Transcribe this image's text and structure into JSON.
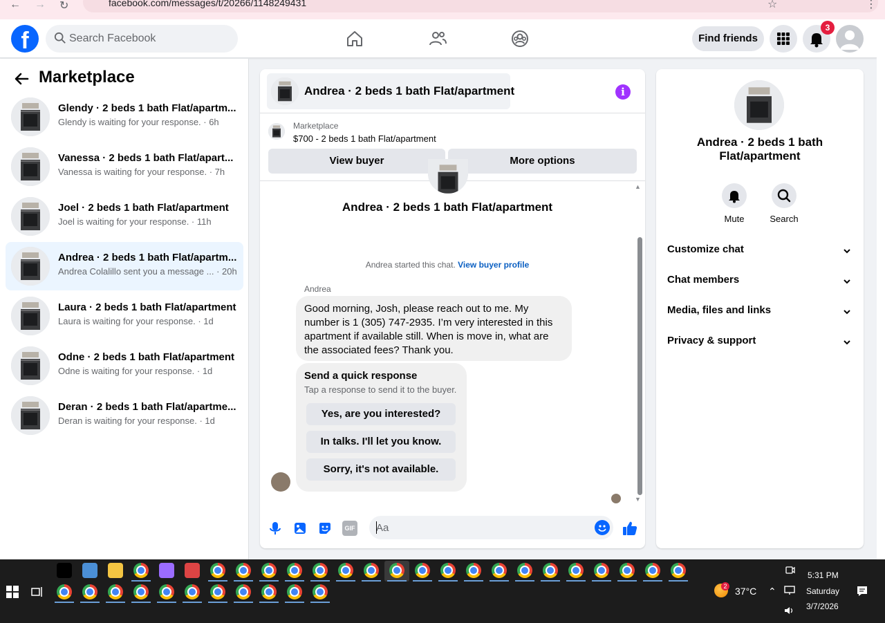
{
  "browser": {
    "url": "facebook.com/messages/t/20266/1148249431"
  },
  "header": {
    "logo_letter": "f",
    "search_placeholder": "Search Facebook",
    "find_friends_label": "Find friends",
    "notification_count": "3"
  },
  "left_panel": {
    "title": "Marketplace",
    "conversations": [
      {
        "name": "Glendy · 2 beds 1 bath Flat/apartm...",
        "preview": "Glendy is waiting for your response. · 6h",
        "active": false
      },
      {
        "name": "Vanessa · 2 beds 1 bath Flat/apart...",
        "preview": "Vanessa is waiting for your response. · 7h",
        "active": false
      },
      {
        "name": "Joel · 2 beds 1 bath Flat/apartment",
        "preview": "Joel is waiting for your response. · 11h",
        "active": false
      },
      {
        "name": "Andrea · 2 beds 1 bath Flat/apartm...",
        "preview": "Andrea Colalillo sent you a message ... · 20h",
        "active": true
      },
      {
        "name": "Laura · 2 beds 1 bath Flat/apartment",
        "preview": "Laura is waiting for your response. · 1d",
        "active": false
      },
      {
        "name": "Odne · 2 beds 1 bath Flat/apartment",
        "preview": "Odne is waiting for your response. · 1d",
        "active": false
      },
      {
        "name": "Deran · 2 beds 1 bath Flat/apartme...",
        "preview": "Deran is waiting for your response. · 1d",
        "active": false
      }
    ]
  },
  "chat": {
    "title": "Andrea · 2 beds 1 bath Flat/apartment",
    "info_letter": "i",
    "marketplace_label": "Marketplace",
    "listing": "$700 - 2 beds 1 bath Flat/apartment",
    "view_buyer_label": "View buyer",
    "more_options_label": "More options",
    "started_text": "Andrea started this chat.",
    "view_buyer_profile_label": "View buyer profile",
    "sender_name": "Andrea",
    "message": "Good morning, Josh,  please reach out to me. My number is 1 (305) 747-2935. I’m very interested in this apartment if available still. When is move in, what are the associated fees? Thank you.",
    "quick_response_title": "Send a quick response",
    "quick_response_subtitle": "Tap a response to send it to the buyer.",
    "quick_responses": [
      "Yes, are you interested?",
      "In talks. I'll let you know.",
      "Sorry, it's not available."
    ],
    "composer_placeholder": "Aa",
    "gif_label": "GIF"
  },
  "right_panel": {
    "name": "Andrea · 2 beds 1 bath Flat/apartment",
    "mute_label": "Mute",
    "search_label": "Search",
    "sections": [
      "Customize chat",
      "Chat members",
      "Media, files and links",
      "Privacy & support"
    ]
  },
  "taskbar": {
    "temperature": "37°C",
    "time": "5:31 PM",
    "day": "Saturday",
    "date": "3/7/2026",
    "weather_badge": "2"
  },
  "colors": {
    "brand_blue": "#0866ff",
    "active_conv_bg": "#ebf5ff",
    "info_purple": "#a033ff",
    "badge_red": "#e41e3f"
  }
}
